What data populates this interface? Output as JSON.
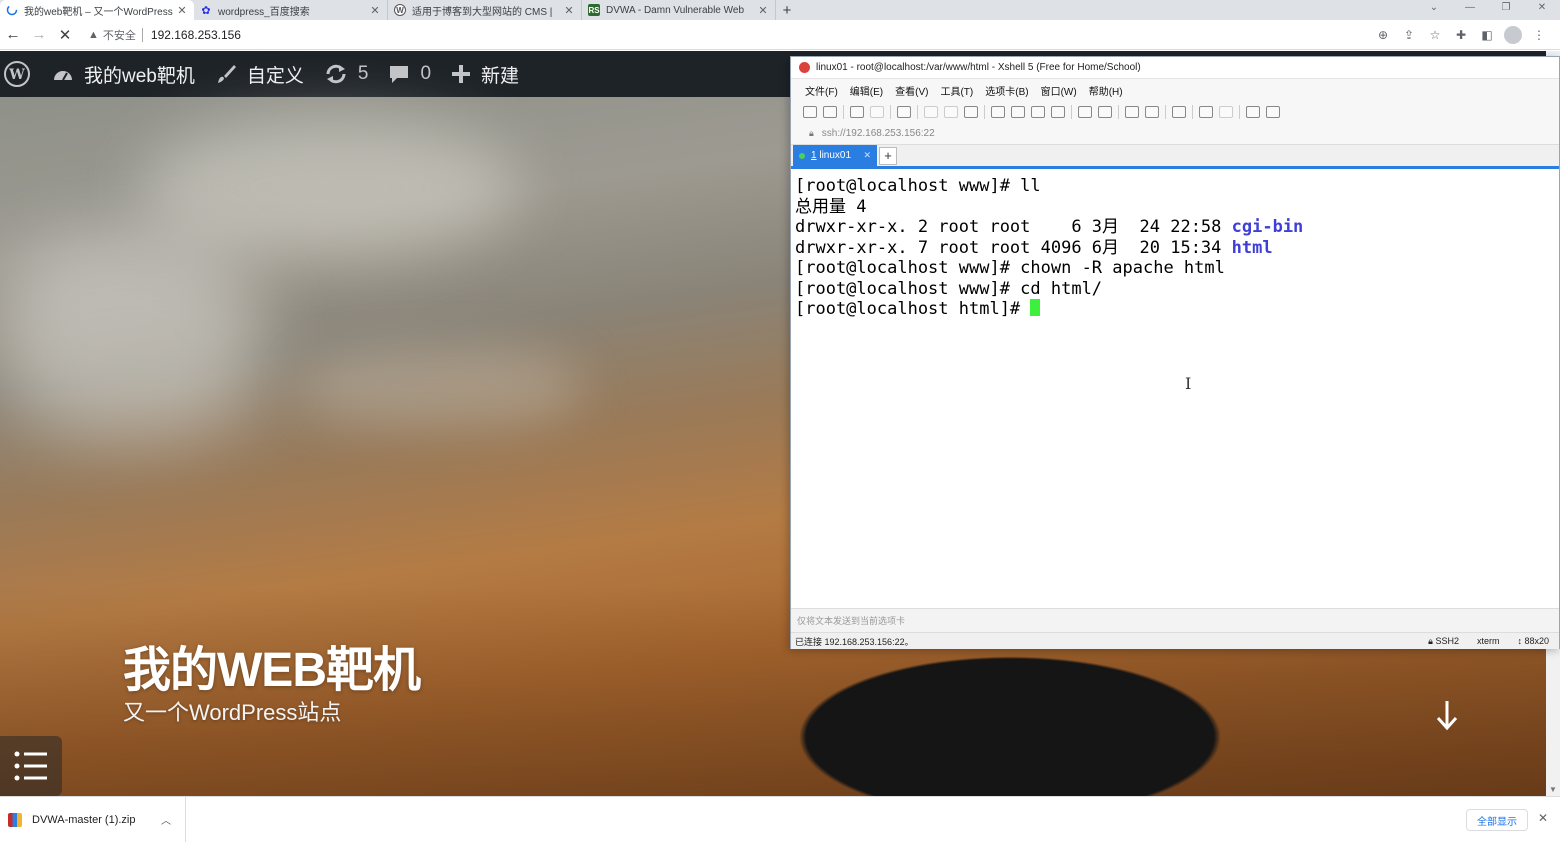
{
  "browser": {
    "tabs": [
      {
        "title": "我的web靶机 – 又一个WordPress",
        "active": true
      },
      {
        "title": "wordpress_百度搜索",
        "active": false
      },
      {
        "title": "适用于博客到大型网站的 CMS |",
        "active": false
      },
      {
        "title": "DVWA - Damn Vulnerable Web",
        "active": false
      }
    ],
    "new_tab": "+",
    "security_label": "不安全",
    "url": "192.168.253.156"
  },
  "wp": {
    "adminbar": {
      "site_name": "我的web靶机",
      "customize": "自定义",
      "updates_count": "5",
      "comments_count": "0",
      "new_label": "新建"
    },
    "hero": {
      "title": "我的WEB靶机",
      "subtitle": "又一个WordPress站点"
    }
  },
  "xshell": {
    "title": "linux01 - root@localhost:/var/www/html - Xshell 5 (Free for Home/School)",
    "menu": [
      "文件(F)",
      "编辑(E)",
      "查看(V)",
      "工具(T)",
      "选项卡(B)",
      "窗口(W)",
      "帮助(H)"
    ],
    "address": "ssh://192.168.253.156:22",
    "tab_number": "1",
    "tab_name": "linux01",
    "terminal": {
      "l1": "[root@localhost www]# ll",
      "l2": "总用量 4",
      "l3_pre": "drwxr-xr-x. 2 root root    6 3月  24 22:58 ",
      "l3_dir": "cgi-bin",
      "l4_pre": "drwxr-xr-x. 7 root root 4096 6月  20 15:34 ",
      "l4_dir": "html",
      "l5": "[root@localhost www]# chown -R apache html",
      "l6": "[root@localhost www]# cd html/",
      "l7": "[root@localhost html]# "
    },
    "compose_placeholder": "仅将文本发送到当前选项卡",
    "status": {
      "connection": "已连接 192.168.253.156:22。",
      "protocol": "SSH2",
      "term": "xterm",
      "size": "88x20"
    }
  },
  "downloads": {
    "file": "DVWA-master (1).zip",
    "show_all": "全部显示"
  }
}
